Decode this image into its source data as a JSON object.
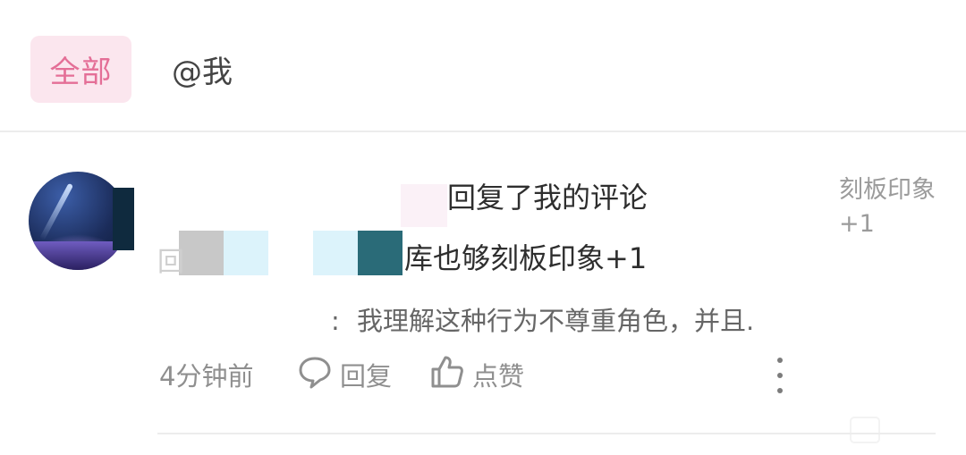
{
  "tabs": {
    "all_label": "全部",
    "mentions_label": "@我"
  },
  "notification": {
    "title_suffix": "回复了我的评论",
    "reply_prefix": "回",
    "reply_text": "库也够刻板印象+1",
    "quote_prefix": ":",
    "quote_text": "我理解这种行为不尊重角色，并且.",
    "time": "4分钟前",
    "reply_action_label": "回复",
    "like_action_label": "点赞",
    "side_preview": "刻板印象+1"
  },
  "colors": {
    "accent": "#e46f97",
    "accent_bg": "#fbe6ee",
    "meta_gray": "#8f8f8f"
  },
  "icons": {
    "reply": "speech-bubble-icon",
    "like": "thumbs-up-icon",
    "more": "vertical-ellipsis-icon"
  }
}
